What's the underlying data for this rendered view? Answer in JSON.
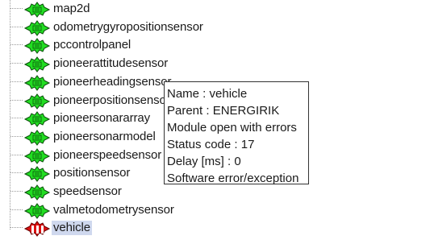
{
  "tree": {
    "items": [
      {
        "label": "map2d",
        "icon": "puzzle-green-icon",
        "status": "ok"
      },
      {
        "label": "odometrygyropositionsensor",
        "icon": "puzzle-green-icon",
        "status": "ok"
      },
      {
        "label": "pccontrolpanel",
        "icon": "puzzle-green-icon",
        "status": "ok"
      },
      {
        "label": "pioneerattitudesensor",
        "icon": "puzzle-green-icon",
        "status": "ok"
      },
      {
        "label": "pioneerheadingsensor",
        "icon": "puzzle-green-icon",
        "status": "ok"
      },
      {
        "label": "pioneerpositionsensor",
        "icon": "puzzle-green-icon",
        "status": "ok"
      },
      {
        "label": "pioneersonararray",
        "icon": "puzzle-green-icon",
        "status": "ok"
      },
      {
        "label": "pioneersonarmodel",
        "icon": "puzzle-green-icon",
        "status": "ok"
      },
      {
        "label": "pioneerspeedsensor",
        "icon": "puzzle-green-icon",
        "status": "ok"
      },
      {
        "label": "positionsensor",
        "icon": "puzzle-green-icon",
        "status": "ok"
      },
      {
        "label": "speedsensor",
        "icon": "puzzle-green-icon",
        "status": "ok"
      },
      {
        "label": "valmetodometrysensor",
        "icon": "puzzle-green-icon",
        "status": "ok"
      },
      {
        "label": "vehicle",
        "icon": "puzzle-red-icon",
        "status": "error",
        "selected": true
      }
    ]
  },
  "tooltip": {
    "lines": [
      "Name : vehicle",
      "Parent : ENERGIRIK",
      "Module open with errors",
      "Status code : 17",
      "Delay [ms] : 0",
      "Software error/exception"
    ]
  },
  "colors": {
    "ok_icon": "#22dd22",
    "error_icon": "#dd1111",
    "selection": "#cfd8ee"
  }
}
